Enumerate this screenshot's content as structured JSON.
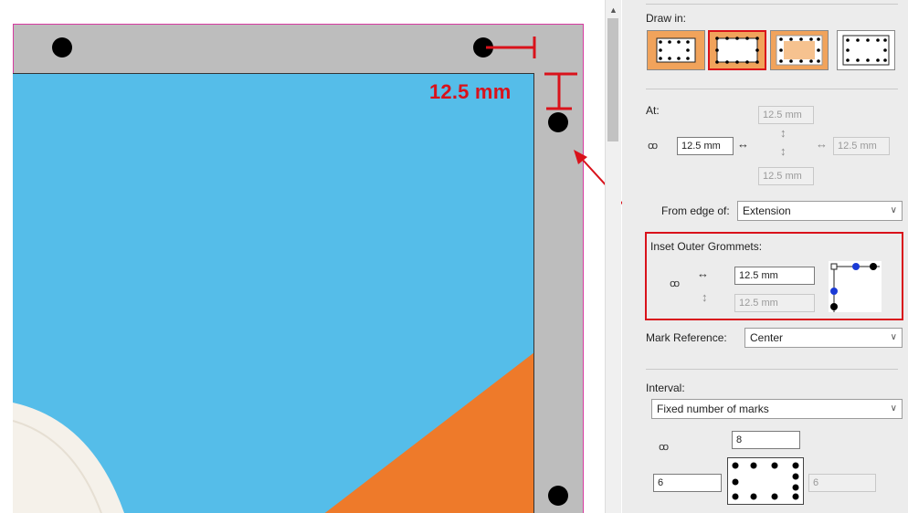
{
  "canvas": {
    "dimension_label": "12.5 mm",
    "colors": {
      "artboard": "#bdbdbd",
      "image_sky": "#55bde9",
      "image_orange": "#ee7a2a",
      "annotation": "#d9121b",
      "bleed_line": "#d63aa0"
    }
  },
  "panel": {
    "draw_in_label": "Draw in:",
    "draw_in_options": [
      "grommets-outside-border",
      "grommets-on-border-selected",
      "grommets-inside-border",
      "grommets-no-fill"
    ],
    "at_label": "At:",
    "at_left_value": "12.5 mm",
    "at_top_value": "12.5 mm",
    "at_bottom_value": "12.5 mm",
    "at_right_value": "12.5 mm",
    "from_edge_label": "From edge of:",
    "from_edge_value": "Extension",
    "inset_label": "Inset Outer Grommets:",
    "inset_horizontal_value": "12.5 mm",
    "inset_vertical_value": "12.5 mm",
    "mark_reference_label": "Mark Reference:",
    "mark_reference_value": "Center",
    "interval_label": "Interval:",
    "interval_value": "Fixed number of marks",
    "marks_horizontal": "8",
    "marks_left": "6",
    "marks_right": "6",
    "icons": {
      "link": "link-icon",
      "horizontal": "horizontal-arrow-icon",
      "vertical": "vertical-arrow-icon",
      "dropdown": "chevron-down-icon"
    }
  }
}
